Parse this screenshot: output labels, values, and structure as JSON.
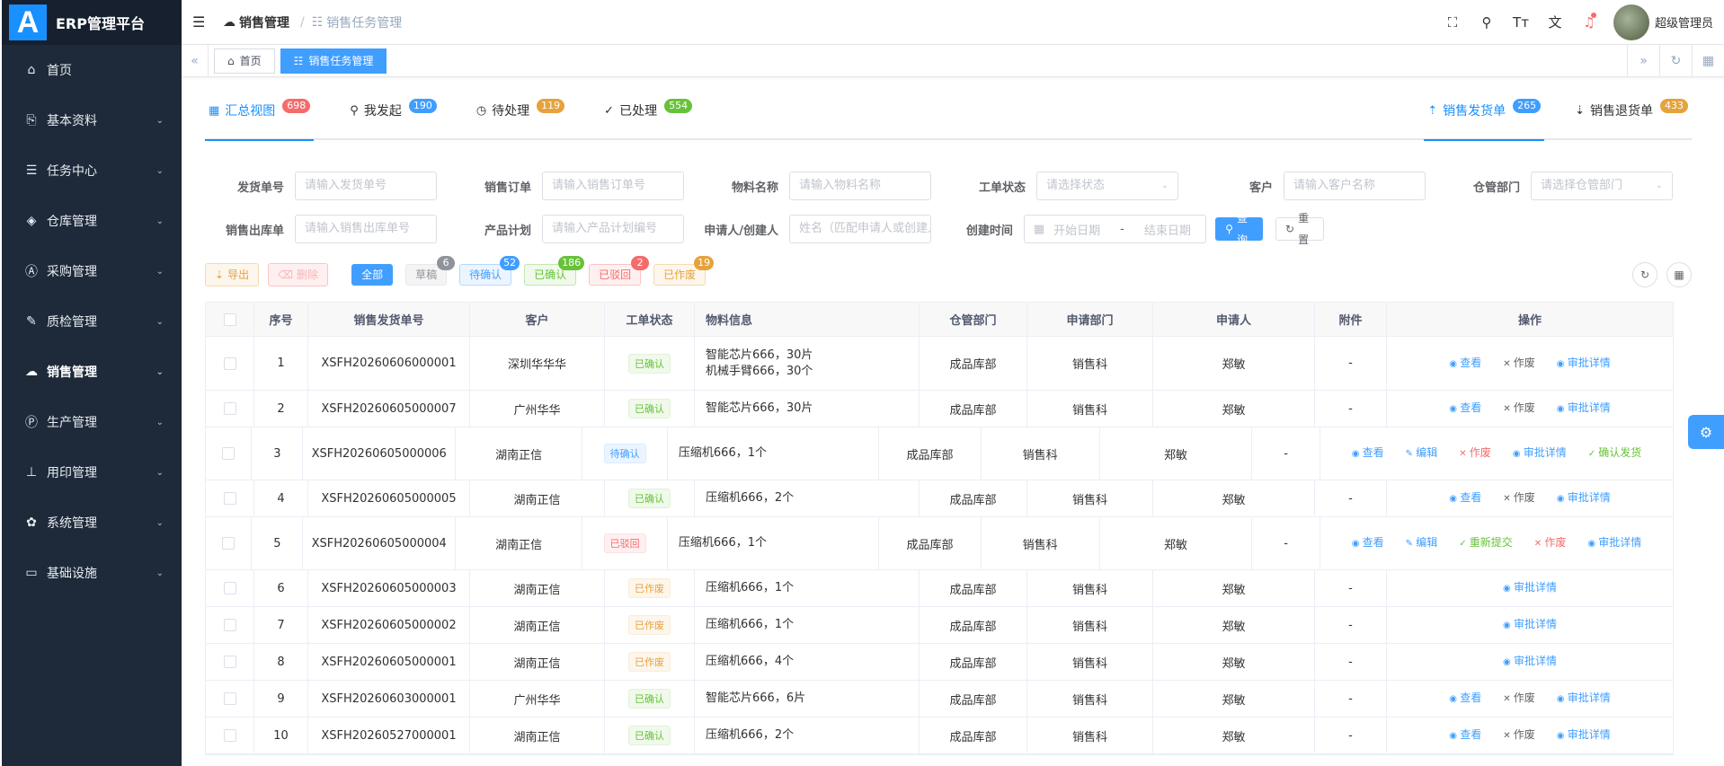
{
  "app": {
    "logo_letter": "A",
    "title": "ERP管理平台"
  },
  "sidebar": {
    "items": [
      {
        "label": "首页",
        "icon": "home-icon",
        "glyph": "⌂",
        "has_children": false,
        "active": false
      },
      {
        "label": "基本资料",
        "icon": "copy-icon",
        "glyph": "⎘",
        "has_children": true,
        "active": false
      },
      {
        "label": "任务中心",
        "icon": "list-icon",
        "glyph": "☰",
        "has_children": true,
        "active": false
      },
      {
        "label": "仓库管理",
        "icon": "box-icon",
        "glyph": "◈",
        "has_children": true,
        "active": false
      },
      {
        "label": "采购管理",
        "icon": "a-icon",
        "glyph": "Ⓐ",
        "has_children": true,
        "active": false
      },
      {
        "label": "质检管理",
        "icon": "brush-icon",
        "glyph": "✎",
        "has_children": true,
        "active": false
      },
      {
        "label": "销售管理",
        "icon": "cloud-icon",
        "glyph": "☁",
        "has_children": true,
        "active": true
      },
      {
        "label": "生产管理",
        "icon": "p-icon",
        "glyph": "Ⓟ",
        "has_children": true,
        "active": false
      },
      {
        "label": "用印管理",
        "icon": "stamp-icon",
        "glyph": "⊥",
        "has_children": true,
        "active": false
      },
      {
        "label": "系统管理",
        "icon": "gear-icon",
        "glyph": "✿",
        "has_children": true,
        "active": false
      },
      {
        "label": "基础设施",
        "icon": "monitor-icon",
        "glyph": "▭",
        "has_children": true,
        "active": false
      }
    ]
  },
  "navbar": {
    "breadcrumb": [
      "销售管理",
      "销售任务管理"
    ],
    "user": "超级管理员"
  },
  "tagsbar": {
    "tags": [
      {
        "label": "首页",
        "active": false
      },
      {
        "label": "销售任务管理",
        "active": true
      }
    ]
  },
  "tabs": {
    "left": [
      {
        "label": "汇总视图",
        "count": "698",
        "color": "red",
        "active": true,
        "icon": "grid-icon",
        "glyph": "▦"
      },
      {
        "label": "我发起",
        "count": "190",
        "color": "blue",
        "active": false,
        "icon": "user-icon",
        "glyph": "⚲"
      },
      {
        "label": "待处理",
        "count": "119",
        "color": "orange",
        "active": false,
        "icon": "clock-icon",
        "glyph": "◷"
      },
      {
        "label": "已处理",
        "count": "554",
        "color": "green",
        "active": false,
        "icon": "check-icon",
        "glyph": "✓"
      }
    ],
    "right": [
      {
        "label": "销售发货单",
        "count": "265",
        "color": "blue",
        "active": true,
        "icon": "upload-icon",
        "glyph": "⇡"
      },
      {
        "label": "销售退货单",
        "count": "433",
        "color": "orange",
        "active": false,
        "icon": "download-icon",
        "glyph": "⇣"
      }
    ]
  },
  "filters": {
    "row1": [
      {
        "label": "发货单号",
        "placeholder": "请输入发货单号",
        "select": false
      },
      {
        "label": "销售订单",
        "placeholder": "请输入销售订单号",
        "select": false
      },
      {
        "label": "物料名称",
        "placeholder": "请输入物料名称",
        "select": false
      },
      {
        "label": "工单状态",
        "placeholder": "请选择状态",
        "select": true
      },
      {
        "label": "客户",
        "placeholder": "请输入客户名称",
        "select": false
      },
      {
        "label": "仓管部门",
        "placeholder": "请选择仓管部门",
        "select": true
      }
    ],
    "row2": [
      {
        "label": "销售出库单",
        "placeholder": "请输入销售出库单号",
        "select": false
      },
      {
        "label": "产品计划",
        "placeholder": "请输入产品计划编号",
        "select": false
      },
      {
        "label": "申请人/创建人",
        "placeholder": "姓名（匹配申请人或创建人）",
        "select": false
      }
    ],
    "date": {
      "label": "创建时间",
      "start": "开始日期",
      "sep": "-",
      "end": "结束日期"
    },
    "search_label": "查询",
    "reset_label": "重置"
  },
  "toolbar": {
    "export_label": "导出",
    "delete_label": "删除",
    "chips": [
      {
        "label": "全部",
        "count": "",
        "kind": "all"
      },
      {
        "label": "草稿",
        "count": "6",
        "kind": "draft"
      },
      {
        "label": "待确认",
        "count": "52",
        "kind": "wait"
      },
      {
        "label": "已确认",
        "count": "186",
        "kind": "ok"
      },
      {
        "label": "已驳回",
        "count": "2",
        "kind": "rej"
      },
      {
        "label": "已作废",
        "count": "19",
        "kind": "void"
      }
    ]
  },
  "table": {
    "headers": [
      "序号",
      "销售发货单号",
      "客户",
      "工单状态",
      "物料信息",
      "仓管部门",
      "申请部门",
      "申请人",
      "附件",
      "操作"
    ],
    "rows": [
      {
        "no": "1",
        "code": "XSFH20260606000001",
        "customer": "深圳华华华",
        "status": "已确认",
        "status_kind": "ok",
        "materials": [
          "智能芯片666，30片",
          "机械手臂666，30个"
        ],
        "wh": "成品库部",
        "dept": "销售科",
        "applicant": "郑敏",
        "attach": "-",
        "ops": [
          "查看",
          "作废",
          "审批详情"
        ],
        "h": 60
      },
      {
        "no": "2",
        "code": "XSFH20260605000007",
        "customer": "广州华华",
        "status": "已确认",
        "status_kind": "ok",
        "materials": [
          "智能芯片666，30片"
        ],
        "wh": "成品库部",
        "dept": "销售科",
        "applicant": "郑敏",
        "attach": "-",
        "ops": [
          "查看",
          "作废",
          "审批详情"
        ],
        "h": 41
      },
      {
        "no": "3",
        "code": "XSFH20260605000006",
        "customer": "湖南正信",
        "status": "待确认",
        "status_kind": "wait",
        "materials": [
          "压缩机666，1个"
        ],
        "wh": "成品库部",
        "dept": "销售科",
        "applicant": "郑敏",
        "attach": "-",
        "ops": [
          "查看",
          "编辑",
          "作废",
          "审批详情",
          "确认发货"
        ],
        "h": 59
      },
      {
        "no": "4",
        "code": "XSFH20260605000005",
        "customer": "湖南正信",
        "status": "已确认",
        "status_kind": "ok",
        "materials": [
          "压缩机666，2个"
        ],
        "wh": "成品库部",
        "dept": "销售科",
        "applicant": "郑敏",
        "attach": "-",
        "ops": [
          "查看",
          "作废",
          "审批详情"
        ],
        "h": 41
      },
      {
        "no": "5",
        "code": "XSFH20260605000004",
        "customer": "湖南正信",
        "status": "已驳回",
        "status_kind": "rej",
        "materials": [
          "压缩机666，1个"
        ],
        "wh": "成品库部",
        "dept": "销售科",
        "applicant": "郑敏",
        "attach": "-",
        "ops": [
          "查看",
          "编辑",
          "重新提交",
          "作废",
          "审批详情"
        ],
        "h": 59
      },
      {
        "no": "6",
        "code": "XSFH20260605000003",
        "customer": "湖南正信",
        "status": "已作废",
        "status_kind": "void",
        "materials": [
          "压缩机666，1个"
        ],
        "wh": "成品库部",
        "dept": "销售科",
        "applicant": "郑敏",
        "attach": "-",
        "ops": [
          "审批详情"
        ],
        "h": 41
      },
      {
        "no": "7",
        "code": "XSFH20260605000002",
        "customer": "湖南正信",
        "status": "已作废",
        "status_kind": "void",
        "materials": [
          "压缩机666，1个"
        ],
        "wh": "成品库部",
        "dept": "销售科",
        "applicant": "郑敏",
        "attach": "-",
        "ops": [
          "审批详情"
        ],
        "h": 41
      },
      {
        "no": "8",
        "code": "XSFH20260605000001",
        "customer": "湖南正信",
        "status": "已作废",
        "status_kind": "void",
        "materials": [
          "压缩机666，4个"
        ],
        "wh": "成品库部",
        "dept": "销售科",
        "applicant": "郑敏",
        "attach": "-",
        "ops": [
          "审批详情"
        ],
        "h": 41
      },
      {
        "no": "9",
        "code": "XSFH20260603000001",
        "customer": "广州华华",
        "status": "已确认",
        "status_kind": "ok",
        "materials": [
          "智能芯片666，6片"
        ],
        "wh": "成品库部",
        "dept": "销售科",
        "applicant": "郑敏",
        "attach": "-",
        "ops": [
          "查看",
          "作废",
          "审批详情"
        ],
        "h": 41
      },
      {
        "no": "10",
        "code": "XSFH20260527000001",
        "customer": "湖南正信",
        "status": "已确认",
        "status_kind": "ok",
        "materials": [
          "压缩机666，2个"
        ],
        "wh": "成品库部",
        "dept": "销售科",
        "applicant": "郑敏",
        "attach": "-",
        "ops": [
          "查看",
          "作废",
          "审批详情"
        ],
        "h": 41
      }
    ]
  }
}
